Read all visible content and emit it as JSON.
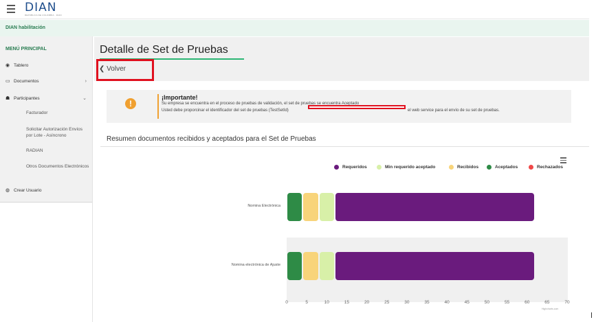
{
  "header": {
    "logo_text": "DIAN",
    "logo_subtitle": "REPUBLICA DE COLOMBIA · DIAN",
    "environment": "DIAN habilitación"
  },
  "sidebar": {
    "heading": "MENÚ PRINCIPAL",
    "items": [
      {
        "label": "Tablero",
        "icon": "dashboard-icon"
      },
      {
        "label": "Documentos",
        "icon": "document-icon",
        "chevron": "›"
      },
      {
        "label": "Participantes",
        "icon": "users-icon",
        "chevron": "⌄"
      },
      {
        "label": "Crear Usuario",
        "icon": "user-add-icon"
      }
    ],
    "subitems": [
      "Facturador",
      "Solicitar Autorización Envíos por Lote - Asíncrono",
      "RADIAN",
      "Otros Documentos Electrónicos"
    ]
  },
  "page": {
    "title": "Detalle de Set de Pruebas",
    "back_label": "Volver"
  },
  "alert": {
    "title": "¡Importante!",
    "line1": "Su empresa se encuentra en el proceso de pruebas de validación, el set de pruebas se encuentra Aceptado",
    "line2_start": "Usted debe proporcinar el identificador del set de pruebas (TestSetId)",
    "line2_end": "el web service para el envío de su set de pruebas."
  },
  "section": {
    "title": "Resumen documentos recibidos y aceptados para el Set de Pruebas"
  },
  "chart_data": {
    "type": "bar",
    "orientation": "horizontal",
    "stacked": true,
    "categories": [
      "Nomina Electrónica",
      "Nomina electrónica de Ajuste"
    ],
    "series": [
      {
        "name": "Requeridos",
        "color": "#6a1b7d",
        "values": [
          50,
          50
        ]
      },
      {
        "name": "Min requerido aceptado",
        "color": "#d8f0a8",
        "values": [
          4,
          4
        ]
      },
      {
        "name": "Recibidos",
        "color": "#f8d47a",
        "values": [
          4,
          4
        ]
      },
      {
        "name": "Aceptados",
        "color": "#2e8b46",
        "values": [
          4,
          4
        ]
      },
      {
        "name": "Rechazados",
        "color": "#f04848",
        "values": [
          0,
          0
        ]
      }
    ],
    "stack_order": [
      "Aceptados",
      "Recibidos",
      "Min requerido aceptado",
      "Requeridos"
    ],
    "xlim": [
      0,
      70
    ],
    "xticks": [
      "0",
      "5",
      "10",
      "15",
      "20",
      "25",
      "30",
      "35",
      "40",
      "45",
      "50",
      "55",
      "60",
      "65",
      "70"
    ],
    "legend_position": "top-right",
    "credits": "Highcharts.com"
  }
}
